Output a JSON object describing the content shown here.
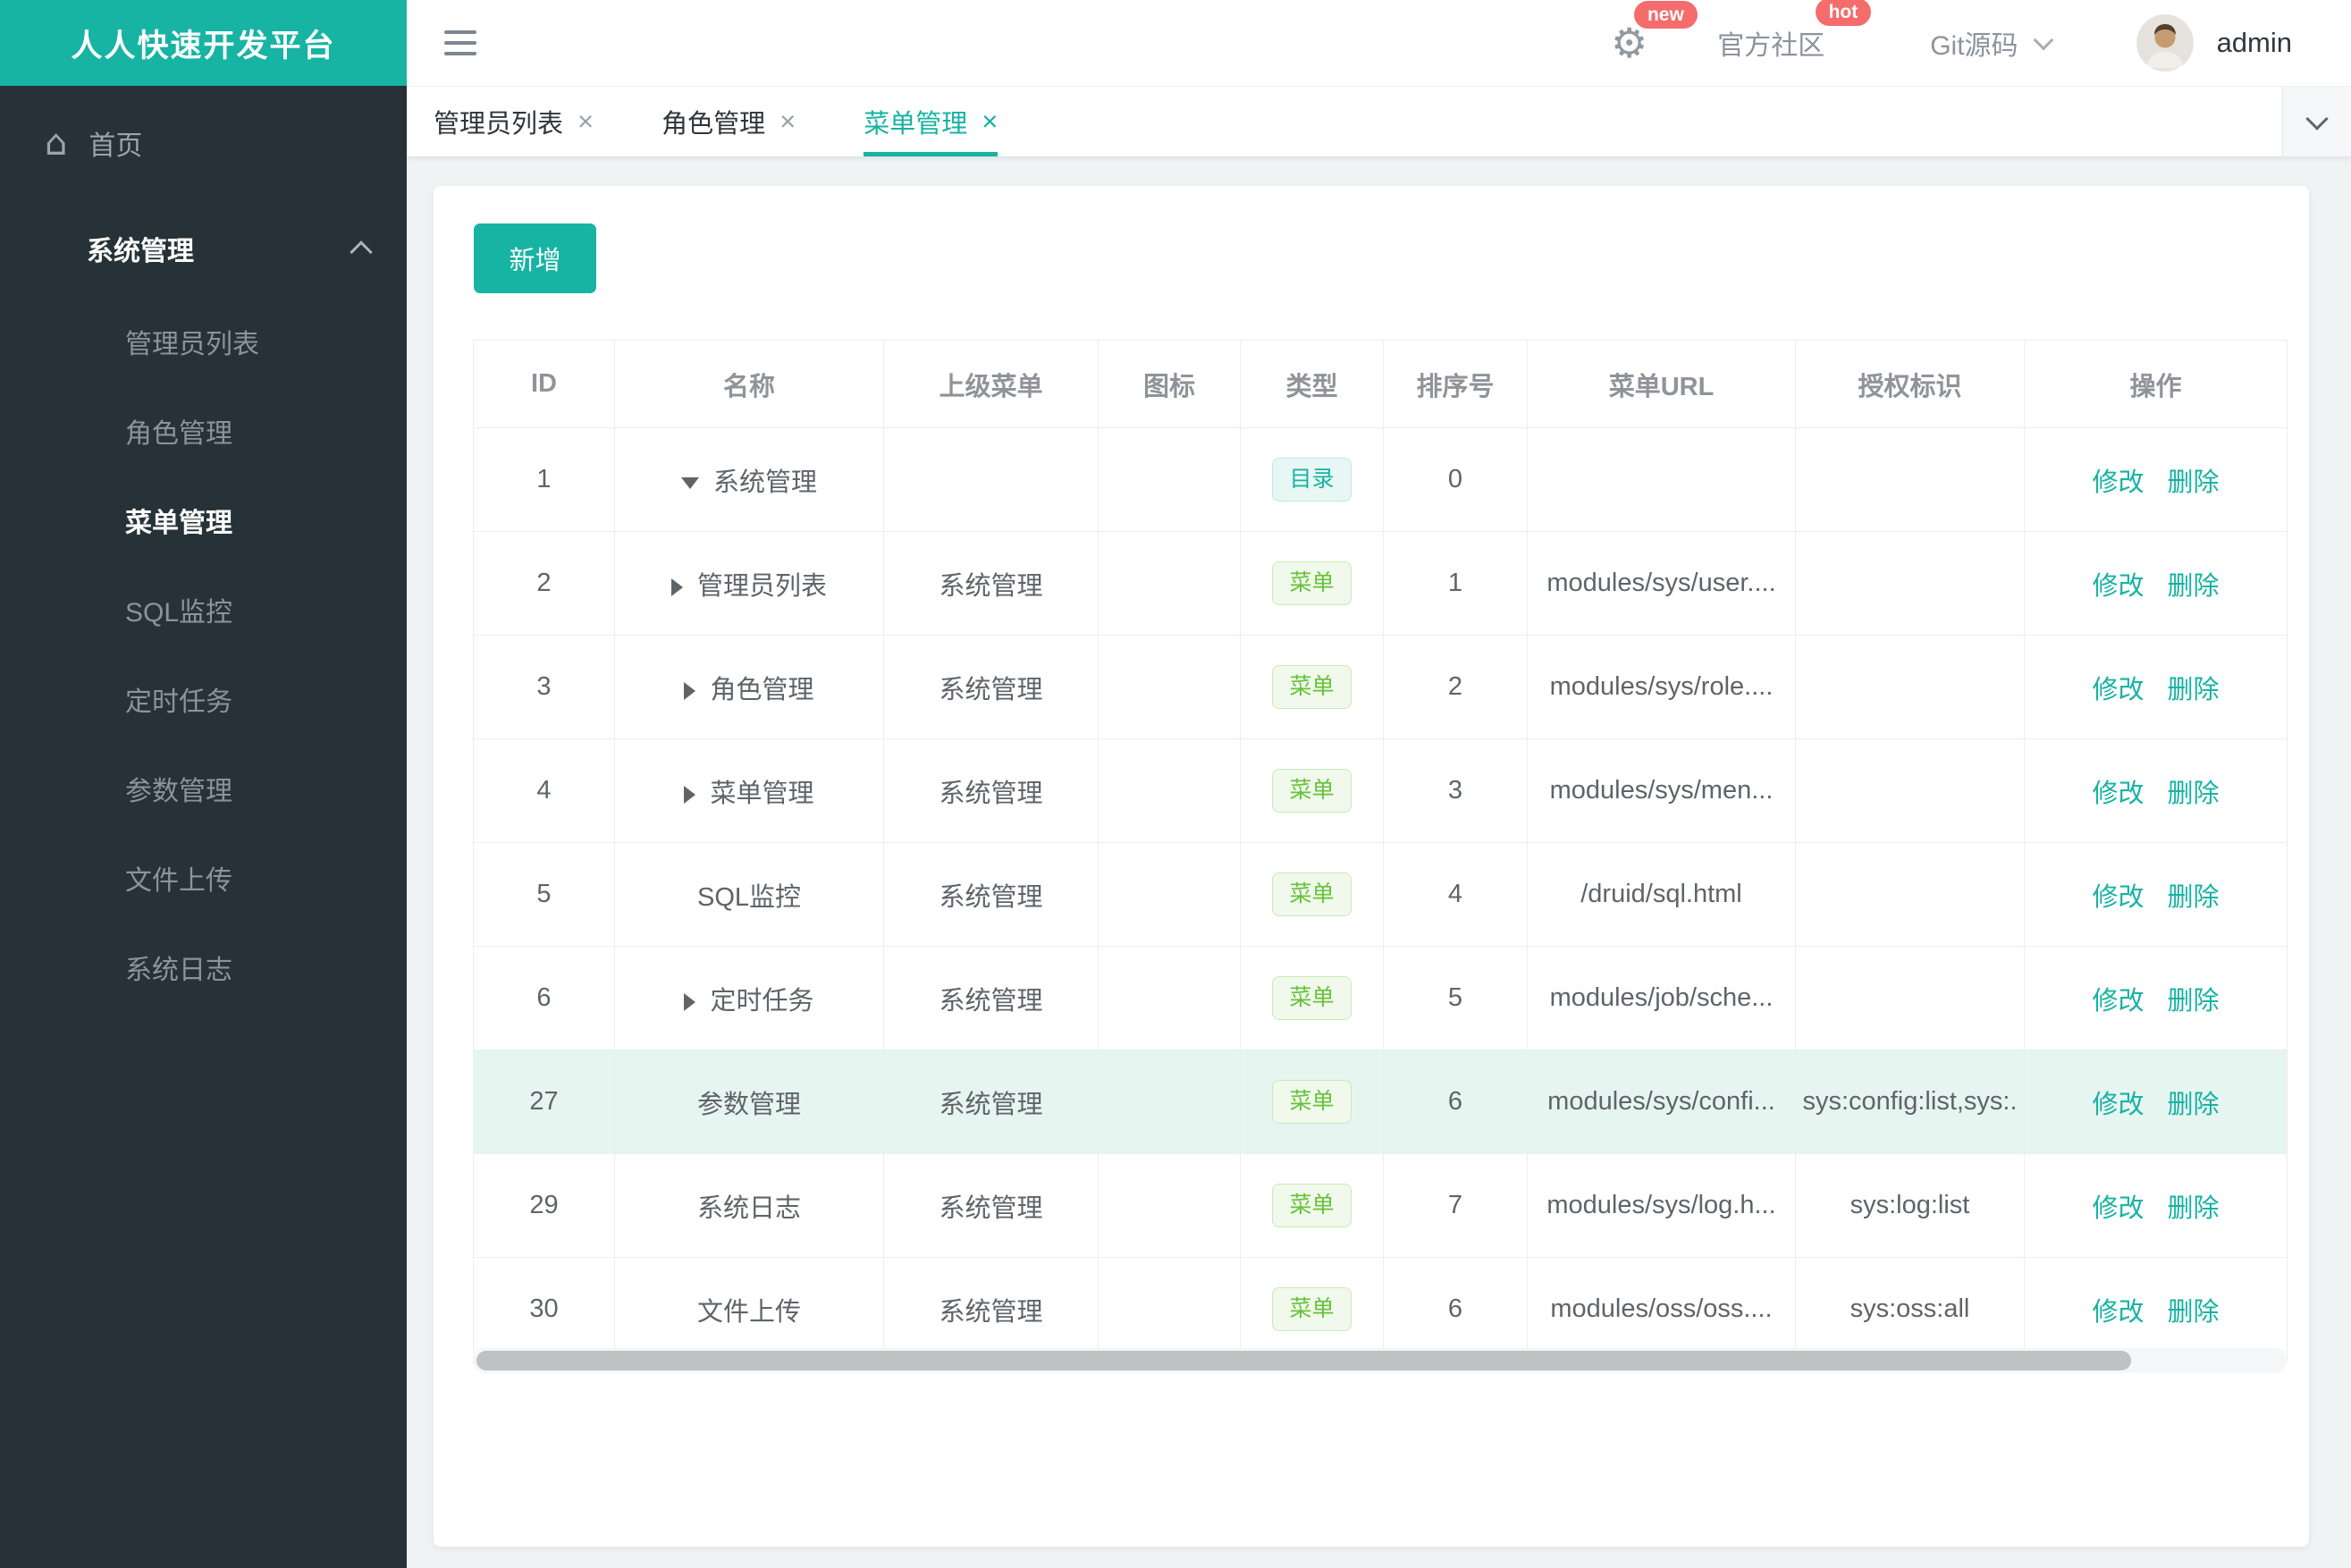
{
  "brand": {
    "title": "人人快速开发平台"
  },
  "icons": {
    "close": "×",
    "gear": "⚙",
    "home": "⌂"
  },
  "topbar": {
    "gear_badge": "new",
    "community": "官方社区",
    "community_badge": "hot",
    "git": "Git源码",
    "username": "admin"
  },
  "sidebar": {
    "home": "首页",
    "section": {
      "label": "系统管理",
      "expanded": true,
      "children": [
        {
          "label": "管理员列表",
          "active": false
        },
        {
          "label": "角色管理",
          "active": false
        },
        {
          "label": "菜单管理",
          "active": true
        },
        {
          "label": "SQL监控",
          "active": false
        },
        {
          "label": "定时任务",
          "active": false
        },
        {
          "label": "参数管理",
          "active": false
        },
        {
          "label": "文件上传",
          "active": false
        },
        {
          "label": "系统日志",
          "active": false
        }
      ]
    }
  },
  "tabs": {
    "items": [
      {
        "label": "管理员列表",
        "active": false
      },
      {
        "label": "角色管理",
        "active": false
      },
      {
        "label": "菜单管理",
        "active": true
      }
    ]
  },
  "toolbar": {
    "add": "新增"
  },
  "table": {
    "columns": [
      "ID",
      "名称",
      "上级菜单",
      "图标",
      "类型",
      "排序号",
      "菜单URL",
      "授权标识",
      "操作"
    ],
    "badge_labels": {
      "dir": "目录",
      "menu": "菜单"
    },
    "actions": {
      "edit": "修改",
      "del": "删除"
    },
    "rows": [
      {
        "id": "1",
        "name": "系统管理",
        "arrow": "down",
        "parent": "",
        "icon": "",
        "type": "dir",
        "order": "0",
        "url": "",
        "perms": "",
        "highlight": false
      },
      {
        "id": "2",
        "name": "管理员列表",
        "arrow": "right",
        "parent": "系统管理",
        "icon": "",
        "type": "menu",
        "order": "1",
        "url": "modules/sys/user....",
        "perms": "",
        "highlight": false
      },
      {
        "id": "3",
        "name": "角色管理",
        "arrow": "right",
        "parent": "系统管理",
        "icon": "",
        "type": "menu",
        "order": "2",
        "url": "modules/sys/role....",
        "perms": "",
        "highlight": false
      },
      {
        "id": "4",
        "name": "菜单管理",
        "arrow": "right",
        "parent": "系统管理",
        "icon": "",
        "type": "menu",
        "order": "3",
        "url": "modules/sys/men...",
        "perms": "",
        "highlight": false
      },
      {
        "id": "5",
        "name": "SQL监控",
        "arrow": "none",
        "parent": "系统管理",
        "icon": "",
        "type": "menu",
        "order": "4",
        "url": "/druid/sql.html",
        "perms": "",
        "highlight": false
      },
      {
        "id": "6",
        "name": "定时任务",
        "arrow": "right",
        "parent": "系统管理",
        "icon": "",
        "type": "menu",
        "order": "5",
        "url": "modules/job/sche...",
        "perms": "",
        "highlight": false
      },
      {
        "id": "27",
        "name": "参数管理",
        "arrow": "none",
        "parent": "系统管理",
        "icon": "",
        "type": "menu",
        "order": "6",
        "url": "modules/sys/confi...",
        "perms": "sys:config:list,sys:.",
        "highlight": true
      },
      {
        "id": "29",
        "name": "系统日志",
        "arrow": "none",
        "parent": "系统管理",
        "icon": "",
        "type": "menu",
        "order": "7",
        "url": "modules/sys/log.h...",
        "perms": "sys:log:list",
        "highlight": false
      },
      {
        "id": "30",
        "name": "文件上传",
        "arrow": "none",
        "parent": "系统管理",
        "icon": "",
        "type": "menu",
        "order": "6",
        "url": "modules/oss/oss....",
        "perms": "sys:oss:all",
        "highlight": false
      }
    ]
  },
  "colors": {
    "primary": "#17b3a3",
    "sidebar_bg": "#263238",
    "badge_dir": "#17b3a3",
    "badge_menu": "#67c23a",
    "danger_badge": "#f56c6c",
    "row_highlight": "#e7f5f1"
  }
}
